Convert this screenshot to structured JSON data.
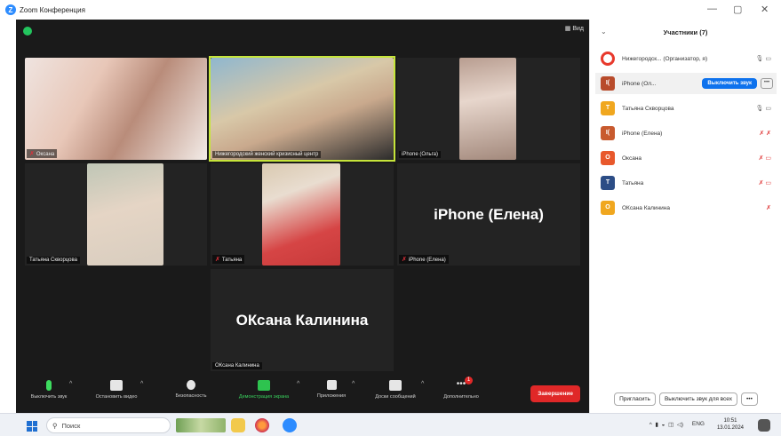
{
  "window": {
    "title": "Zoom Конференция"
  },
  "video": {
    "view_label": "Вид",
    "tiles": [
      {
        "name": "Оксана",
        "muted": true
      },
      {
        "name": "Нижегородский женский кризисный центр",
        "muted": false
      },
      {
        "name": "iPhone (Ольга)",
        "muted": false
      },
      {
        "name": "Татьяна Скворцова",
        "muted": false
      },
      {
        "name": "Татьяна",
        "muted": true
      },
      {
        "name": "iPhone (Елена)",
        "muted": true,
        "big_name": "iPhone (Елена)"
      },
      {
        "name": "ОКсана Калинина",
        "muted": false,
        "big_name": "ОКсана Калинина"
      }
    ]
  },
  "toolbar": {
    "items": [
      {
        "label": "Выключить звук",
        "icon": "mic-icon"
      },
      {
        "label": "Остановить видео",
        "icon": "camera-icon"
      },
      {
        "label": "Безопасность",
        "icon": "shield-icon"
      },
      {
        "label": "Демонстрация экрана",
        "icon": "share-screen-icon"
      },
      {
        "label": "Приложения",
        "icon": "apps-icon"
      },
      {
        "label": "Доски сообщений",
        "icon": "whiteboard-icon"
      },
      {
        "label": "Дополнительно",
        "icon": "more-icon"
      }
    ],
    "badge_count": "1",
    "end_label": "Завершение"
  },
  "participants": {
    "title": "Участники (7)",
    "items": [
      {
        "initial": "",
        "name": "Нижегородск... (Организатор, я)",
        "color": "#e8392c",
        "icons": "🎙 ▭"
      },
      {
        "initial": "I(",
        "name": "iPhone (Ол...",
        "color": "#b84b2b",
        "icons": "",
        "selected": true,
        "button": "Выключить звук"
      },
      {
        "initial": "T",
        "name": "Татьяна Скворцова",
        "color": "#f0a71f",
        "icons": "🎙 ▭"
      },
      {
        "initial": "I(",
        "name": "iPhone (Елена)",
        "color": "#c85a2e",
        "icons": "✗ ✗"
      },
      {
        "initial": "O",
        "name": "Оксана",
        "color": "#e8582c",
        "icons": "✗ ▭"
      },
      {
        "initial": "T",
        "name": "Татьяна",
        "color": "#2c4d86",
        "icons": "✗ ▭"
      },
      {
        "initial": "O",
        "name": "ОКсана Калинина",
        "color": "#f0a71f",
        "icons": "✗"
      }
    ],
    "invite_label": "Пригласить",
    "mute_all_label": "Выключить звук для всех"
  },
  "taskbar": {
    "search_placeholder": "Поиск",
    "lang": "ENG",
    "time": "10:51",
    "date": "13.01.2024"
  }
}
